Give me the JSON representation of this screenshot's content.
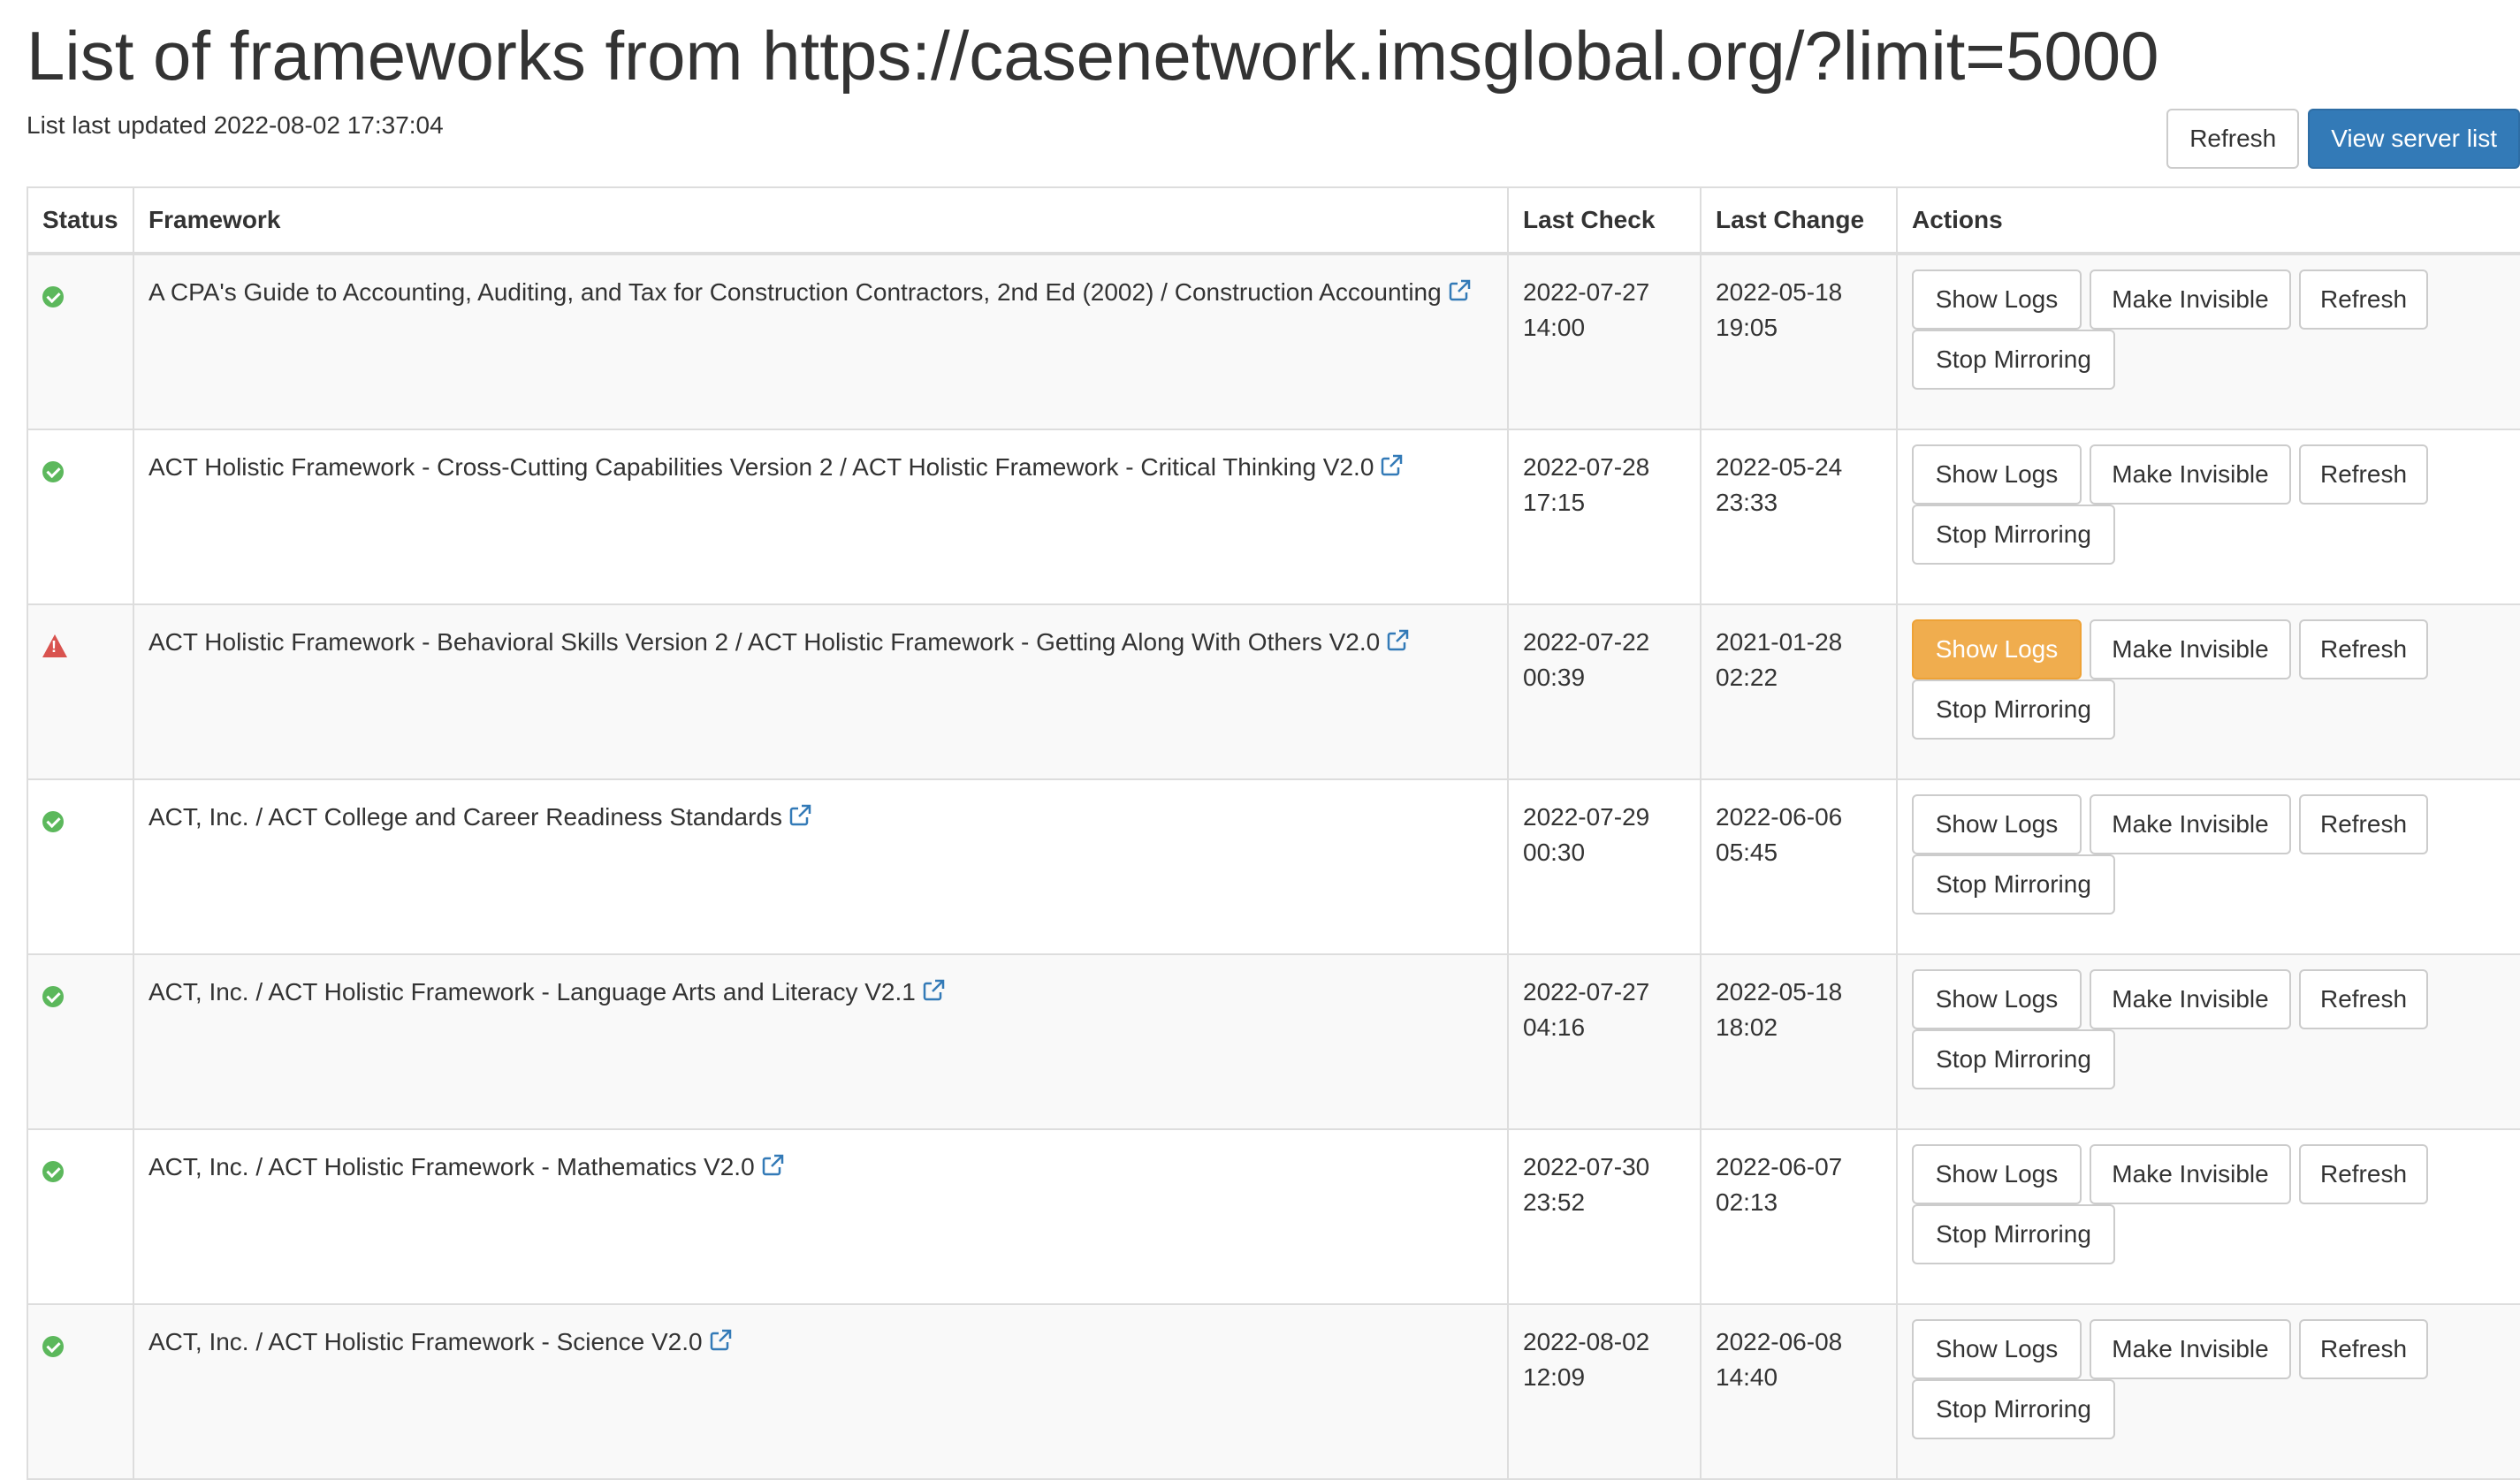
{
  "header": {
    "title": "List of frameworks from https://casenetwork.imsglobal.org/?limit=5000",
    "updated": "List last updated 2022-08-02 17:37:04",
    "refresh_label": "Refresh",
    "view_server_list_label": "View server list"
  },
  "table": {
    "columns": [
      "Status",
      "Framework",
      "Last Check",
      "Last Change",
      "Actions"
    ],
    "action_labels": {
      "show_logs": "Show Logs",
      "make_invisible": "Make Invisible",
      "refresh": "Refresh",
      "stop_mirroring": "Stop Mirroring"
    },
    "rows": [
      {
        "status": "ok",
        "framework": "A CPA's Guide to Accounting, Auditing, and Tax for Construction Contractors, 2nd Ed (2002) / Construction Accounting",
        "last_check_date": "2022-07-27",
        "last_check_time": "14:00",
        "last_change_date": "2022-05-18",
        "last_change_time": "19:05"
      },
      {
        "status": "ok",
        "framework": "ACT Holistic Framework - Cross-Cutting Capabilities Version 2 / ACT Holistic Framework - Critical Thinking V2.0",
        "last_check_date": "2022-07-28",
        "last_check_time": "17:15",
        "last_change_date": "2022-05-24",
        "last_change_time": "23:33"
      },
      {
        "status": "warning",
        "framework": "ACT Holistic Framework - Behavioral Skills Version 2 / ACT Holistic Framework - Getting Along With Others V2.0",
        "last_check_date": "2022-07-22",
        "last_check_time": "00:39",
        "last_change_date": "2021-01-28",
        "last_change_time": "02:22"
      },
      {
        "status": "ok",
        "framework": "ACT, Inc. / ACT College and Career Readiness Standards",
        "last_check_date": "2022-07-29",
        "last_check_time": "00:30",
        "last_change_date": "2022-06-06",
        "last_change_time": "05:45"
      },
      {
        "status": "ok",
        "framework": "ACT, Inc. / ACT Holistic Framework - Language Arts and Literacy V2.1",
        "last_check_date": "2022-07-27",
        "last_check_time": "04:16",
        "last_change_date": "2022-05-18",
        "last_change_time": "18:02"
      },
      {
        "status": "ok",
        "framework": "ACT, Inc. / ACT Holistic Framework - Mathematics V2.0",
        "last_check_date": "2022-07-30",
        "last_check_time": "23:52",
        "last_change_date": "2022-06-07",
        "last_change_time": "02:13"
      },
      {
        "status": "ok",
        "framework": "ACT, Inc. / ACT Holistic Framework - Science V2.0",
        "last_check_date": "2022-08-02",
        "last_check_time": "12:09",
        "last_change_date": "2022-06-08",
        "last_change_time": "14:40"
      }
    ]
  },
  "colors": {
    "ok": "#5cb85c",
    "warning": "#d9534f",
    "primary": "#337ab7",
    "highlight_button": "#f0ad4e",
    "link": "#337ab7"
  },
  "icons": {
    "ok": "check-circle-icon",
    "warning": "warning-triangle-icon",
    "link": "external-link-icon"
  }
}
